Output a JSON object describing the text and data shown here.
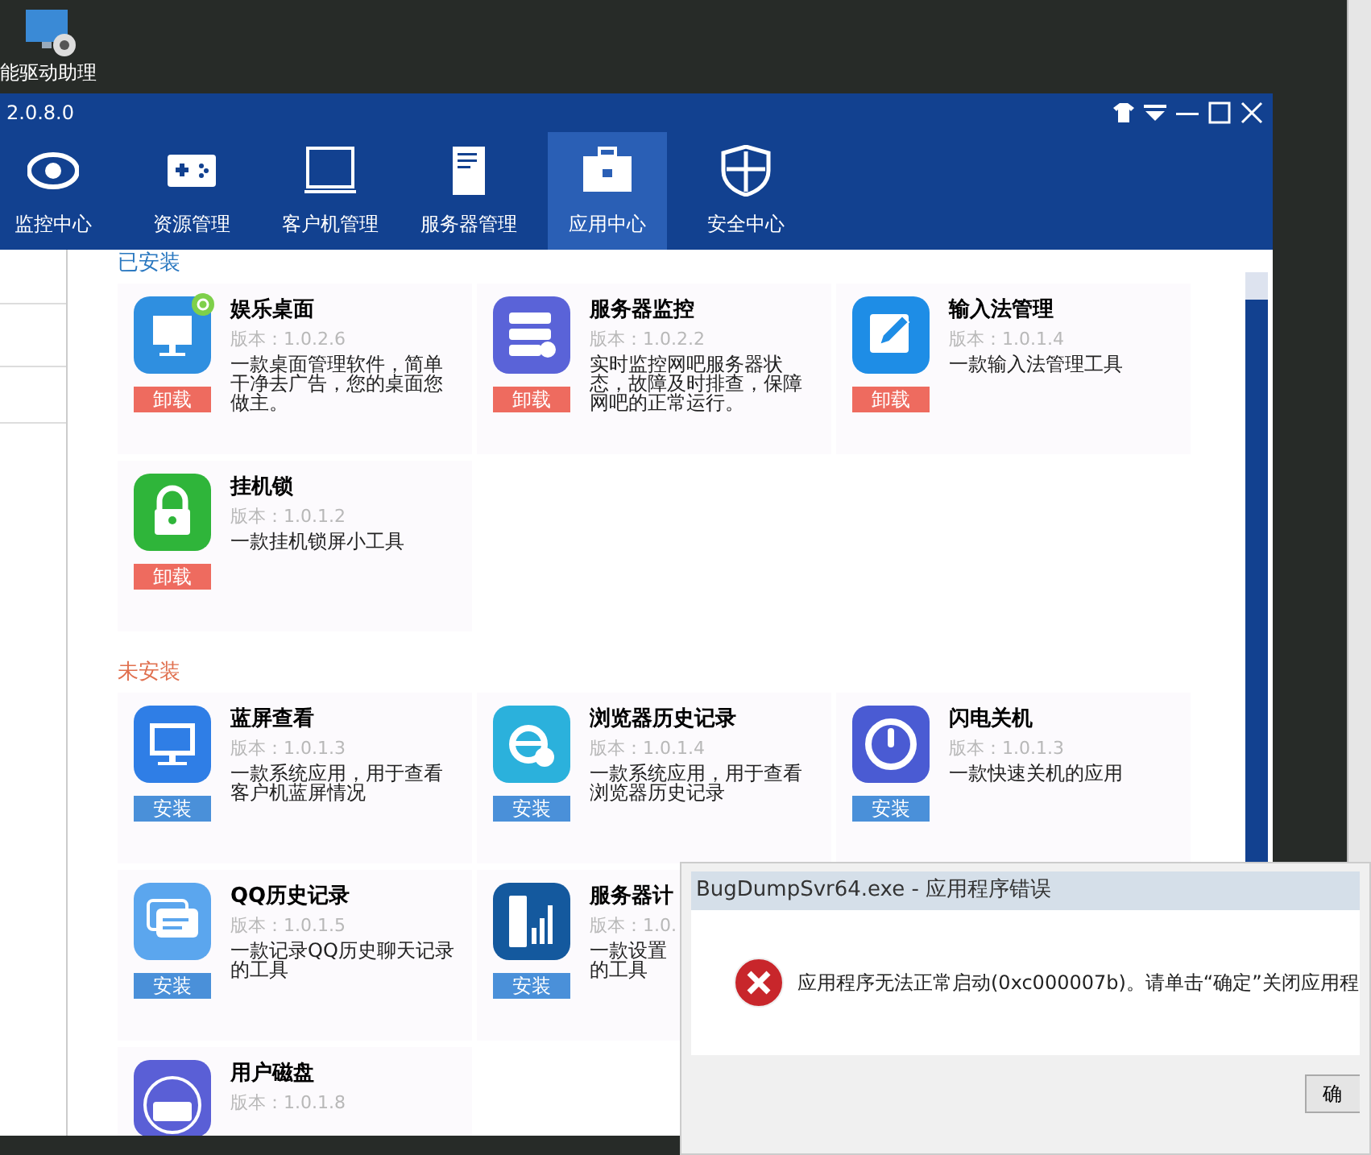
{
  "desktop_icon": {
    "label": "能驱动助理"
  },
  "window": {
    "title": "2.0.8.0"
  },
  "tabs": [
    {
      "label": "监控中心",
      "kind": "eye",
      "selected": false
    },
    {
      "label": "资源管理",
      "kind": "gamepad",
      "selected": false
    },
    {
      "label": "客户机管理",
      "kind": "monitor",
      "selected": false
    },
    {
      "label": "服务器管理",
      "kind": "server",
      "selected": false
    },
    {
      "label": "应用中心",
      "kind": "toolbox",
      "selected": true
    },
    {
      "label": "安全中心",
      "kind": "shield",
      "selected": false
    }
  ],
  "sections": [
    {
      "title": "已安装",
      "installed": true,
      "apps": [
        {
          "name": "娱乐桌面",
          "version": "版本：1.0.2.6",
          "desc_lines": [
            "一款桌面管理软件，简单",
            "干净去广告，您的桌面您",
            "做主。"
          ],
          "button": "卸载",
          "kind": "desktop",
          "color": "#2f8fe0",
          "badge": true
        },
        {
          "name": "服务器监控",
          "version": "版本：1.0.2.2",
          "desc_lines": [
            "实时监控网吧服务器状",
            "态，故障及时排查，保障",
            "网吧的正常运行。"
          ],
          "button": "卸载",
          "kind": "server",
          "color": "#5a63d8"
        },
        {
          "name": "输入法管理",
          "version": "版本：1.0.1.4",
          "desc_lines": [
            "一款输入法管理工具"
          ],
          "button": "卸载",
          "kind": "pencil",
          "color": "#1e8de6"
        },
        {
          "name": "挂机锁",
          "version": "版本：1.0.1.2",
          "desc_lines": [
            "一款挂机锁屏小工具"
          ],
          "button": "卸载",
          "kind": "lock",
          "color": "#2fb53a"
        }
      ]
    },
    {
      "title": "未安装",
      "installed": false,
      "apps": [
        {
          "name": "蓝屏查看",
          "version": "版本：1.0.1.3",
          "desc_lines": [
            "一款系统应用，用于查看",
            "客户机蓝屏情况"
          ],
          "button": "安装",
          "kind": "screen",
          "color": "#2f7ee6"
        },
        {
          "name": "浏览器历史记录",
          "version": "版本：1.0.1.4",
          "desc_lines": [
            "一款系统应用，用于查看",
            "浏览器历史记录"
          ],
          "button": "安装",
          "kind": "browser",
          "color": "#2bb1dc"
        },
        {
          "name": "闪电关机",
          "version": "版本：1.0.1.3",
          "desc_lines": [
            "一款快速关机的应用"
          ],
          "button": "安装",
          "kind": "power",
          "color": "#4a5bd3"
        },
        {
          "name": "QQ历史记录",
          "version": "版本：1.0.1.5",
          "desc_lines": [
            "一款记录QQ历史聊天记录",
            "的工具"
          ],
          "button": "安装",
          "kind": "chat",
          "color": "#5ba6ee"
        },
        {
          "name": "服务器计",
          "version": "版本：1.0.",
          "desc_lines": [
            "一款设置",
            "的工具"
          ],
          "button": "安装",
          "kind": "chart",
          "color": "#14599e"
        },
        {
          "name": "用户磁盘",
          "version": "版本：1.0.1.8",
          "kind": "disk",
          "color": "#5a5fd6"
        }
      ]
    }
  ],
  "error_dialog": {
    "title": "BugDumpSvr64.exe - 应用程序错误",
    "message": "应用程序无法正常启动(0xc000007b)。请单击“确定”关闭应用程",
    "button": "确"
  }
}
